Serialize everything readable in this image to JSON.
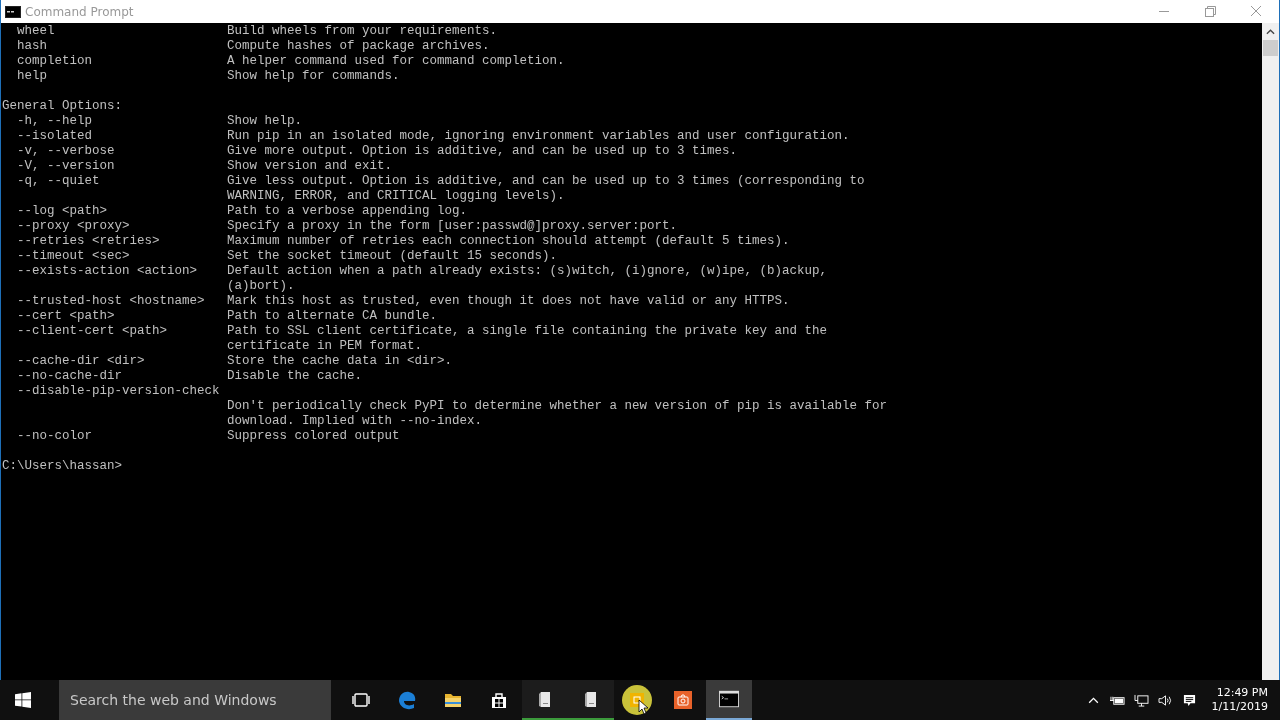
{
  "window": {
    "title": "Command Prompt"
  },
  "console": {
    "lines": [
      {
        "kind": "entry",
        "option": "wheel",
        "text": "Build wheels from your requirements."
      },
      {
        "kind": "entry",
        "option": "hash",
        "text": "Compute hashes of package archives."
      },
      {
        "kind": "entry",
        "option": "completion",
        "text": "A helper command used for command completion."
      },
      {
        "kind": "entry",
        "option": "help",
        "text": "Show help for commands."
      },
      {
        "kind": "blank"
      },
      {
        "kind": "heading",
        "text": "General Options:"
      },
      {
        "kind": "entry",
        "option": "-h, --help",
        "text": "Show help."
      },
      {
        "kind": "entry",
        "option": "--isolated",
        "text": "Run pip in an isolated mode, ignoring environment variables and user configuration."
      },
      {
        "kind": "entry",
        "option": "-v, --verbose",
        "text": "Give more output. Option is additive, and can be used up to 3 times."
      },
      {
        "kind": "entry",
        "option": "-V, --version",
        "text": "Show version and exit."
      },
      {
        "kind": "entry",
        "option": "-q, --quiet",
        "text": "Give less output. Option is additive, and can be used up to 3 times (corresponding to"
      },
      {
        "kind": "entry",
        "text": "WARNING, ERROR, and CRITICAL logging levels)."
      },
      {
        "kind": "entry",
        "option": "--log <path>",
        "text": "Path to a verbose appending log."
      },
      {
        "kind": "entry",
        "option": "--proxy <proxy>",
        "text": "Specify a proxy in the form [user:passwd@]proxy.server:port."
      },
      {
        "kind": "entry",
        "option": "--retries <retries>",
        "text": "Maximum number of retries each connection should attempt (default 5 times)."
      },
      {
        "kind": "entry",
        "option": "--timeout <sec>",
        "text": "Set the socket timeout (default 15 seconds)."
      },
      {
        "kind": "entry",
        "option": "--exists-action <action>",
        "text": "Default action when a path already exists: (s)witch, (i)gnore, (w)ipe, (b)ackup,"
      },
      {
        "kind": "entry",
        "text": "(a)bort)."
      },
      {
        "kind": "entry",
        "option": "--trusted-host <hostname>",
        "text": "Mark this host as trusted, even though it does not have valid or any HTTPS."
      },
      {
        "kind": "entry",
        "option": "--cert <path>",
        "text": "Path to alternate CA bundle."
      },
      {
        "kind": "entry",
        "option": "--client-cert <path>",
        "text": "Path to SSL client certificate, a single file containing the private key and the"
      },
      {
        "kind": "entry",
        "text": "certificate in PEM format."
      },
      {
        "kind": "entry",
        "option": "--cache-dir <dir>",
        "text": "Store the cache data in <dir>."
      },
      {
        "kind": "entry",
        "option": "--no-cache-dir",
        "text": "Disable the cache."
      },
      {
        "kind": "entry",
        "option": "--disable-pip-version-check"
      },
      {
        "kind": "entry",
        "text": "Don't periodically check PyPI to determine whether a new version of pip is available for"
      },
      {
        "kind": "entry",
        "text": "download. Implied with --no-index."
      },
      {
        "kind": "entry",
        "option": "--no-color",
        "text": "Suppress colored output"
      },
      {
        "kind": "blank"
      },
      {
        "kind": "prompt",
        "text": "C:\\Users\\hassan>"
      }
    ]
  },
  "taskbar": {
    "search": {
      "placeholder": "Search the web and Windows"
    },
    "apps": [
      {
        "kind": "task-view",
        "running": false,
        "active": false
      },
      {
        "kind": "edge",
        "running": false,
        "active": false
      },
      {
        "kind": "explorer",
        "running": false,
        "active": false
      },
      {
        "kind": "store",
        "running": false,
        "active": false
      },
      {
        "kind": "device",
        "running": true,
        "active": false
      },
      {
        "kind": "device",
        "running": true,
        "active": false
      },
      {
        "kind": "yellow",
        "running": false,
        "active": false
      },
      {
        "kind": "orange",
        "running": false,
        "active": false
      },
      {
        "kind": "cmd",
        "running": true,
        "active": true
      }
    ],
    "clock": {
      "time": "12:49 PM",
      "date": "1/11/2019"
    }
  }
}
